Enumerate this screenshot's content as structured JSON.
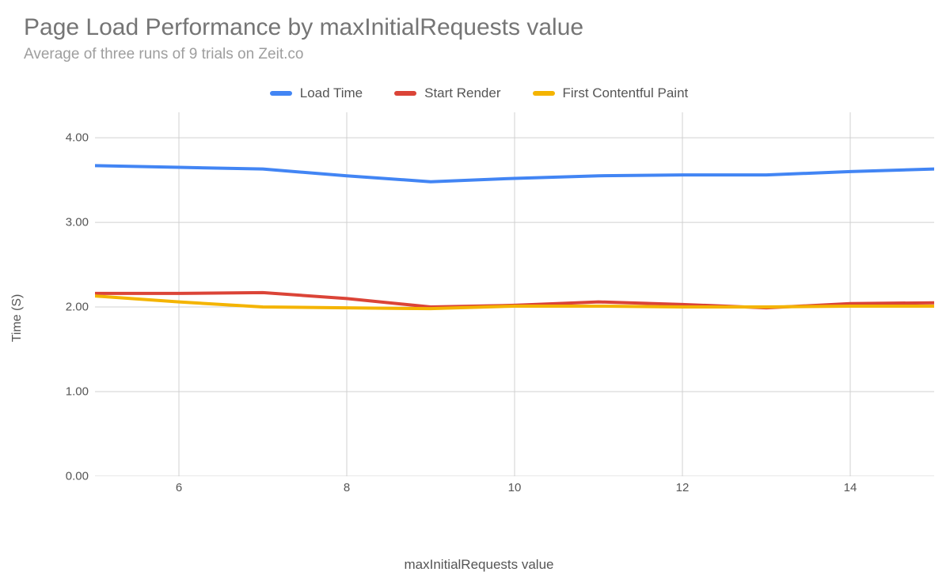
{
  "chart_data": {
    "type": "line",
    "title": "Page Load Performance by maxInitialRequests value",
    "subtitle": "Average of three runs of 9 trials on Zeit.co",
    "xlabel": "maxInitialRequests value",
    "ylabel": "Time (S)",
    "x": [
      5,
      6,
      7,
      8,
      9,
      10,
      11,
      12,
      13,
      14,
      15
    ],
    "series": [
      {
        "name": "Load Time",
        "color": "#4285F4",
        "values": [
          3.67,
          3.65,
          3.63,
          3.55,
          3.48,
          3.52,
          3.55,
          3.56,
          3.56,
          3.6,
          3.63
        ]
      },
      {
        "name": "Start Render",
        "color": "#DB4437",
        "values": [
          2.16,
          2.16,
          2.17,
          2.1,
          2.0,
          2.02,
          2.06,
          2.03,
          1.99,
          2.04,
          2.05
        ]
      },
      {
        "name": "First Contentful Paint",
        "color": "#F4B400",
        "values": [
          2.13,
          2.06,
          2.0,
          1.99,
          1.98,
          2.01,
          2.01,
          2.0,
          2.0,
          2.01,
          2.01
        ]
      }
    ],
    "y_ticks": [
      "0.00",
      "1.00",
      "2.00",
      "3.00",
      "4.00"
    ],
    "y_tick_values": [
      0,
      1,
      2,
      3,
      4
    ],
    "x_ticks": [
      6,
      8,
      10,
      12,
      14
    ],
    "ylim": [
      0,
      4.3
    ],
    "xlim": [
      5,
      15
    ]
  }
}
